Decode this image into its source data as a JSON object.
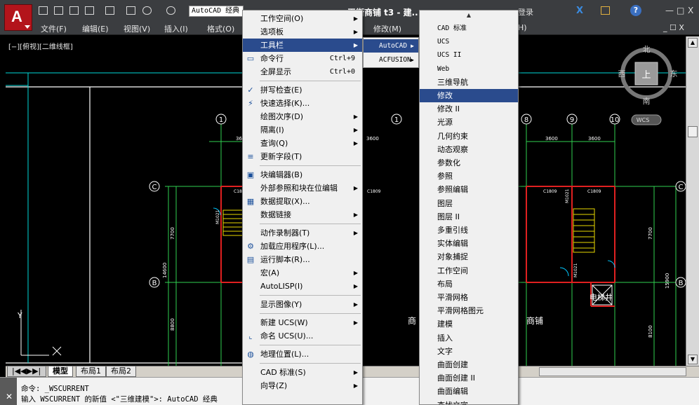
{
  "titlebar": {
    "workspace": "AutoCAD 经典",
    "doc_title": "平街商铺 t3 - 建...",
    "login": "登录",
    "min": "—",
    "max": "□",
    "close": "X",
    "help": "?"
  },
  "menubar": {
    "items": [
      "文件(F)",
      "编辑(E)",
      "视图(V)",
      "插入(I)",
      "格式(O)",
      "修改(M)",
      "H)"
    ],
    "win_restore": "_ ☐ X"
  },
  "viewport": {
    "label": "[−][俯视][二维线框]"
  },
  "navcube": {
    "north": "北",
    "south": "南",
    "east": "东",
    "west": "西",
    "top": "上",
    "wcs": "WCS"
  },
  "plan": {
    "grid_numbers": [
      "1",
      "5",
      "8",
      "9",
      "10"
    ],
    "grid_letters": [
      "C",
      "B",
      "C",
      "B"
    ],
    "dims": [
      "3600",
      "3600",
      "3600",
      "3600",
      "7700",
      "14600",
      "8800",
      "7700",
      "15900",
      "8100"
    ],
    "labels": [
      "C1809",
      "C1809",
      "C1809",
      "C1809",
      "M1021",
      "M1021",
      "M1021",
      "商铺",
      "商铺",
      "电梯井",
      "商"
    ]
  },
  "tabs": [
    "模型",
    "布局1",
    "布局2"
  ],
  "command": {
    "line1": "命令: _WSCURRENT",
    "line2": "输入 WSCURRENT 的新值 <\"三维建模\">: AutoCAD 经典"
  },
  "tools_menu": [
    {
      "label": "工作空间(O)",
      "arrow": true
    },
    {
      "label": "选项板",
      "arrow": true
    },
    {
      "label": "工具栏",
      "arrow": true,
      "highlight": true
    },
    {
      "label": "命令行",
      "shortcut": "Ctrl+9",
      "icon": "cmdline-icon"
    },
    {
      "label": "全屏显示",
      "shortcut": "Ctrl+0"
    },
    {
      "sep": true
    },
    {
      "label": "拼写检查(E)",
      "icon": "spellcheck-icon"
    },
    {
      "label": "快速选择(K)...",
      "icon": "quickselect-icon"
    },
    {
      "label": "绘图次序(D)",
      "arrow": true
    },
    {
      "label": "隔离(I)",
      "arrow": true
    },
    {
      "label": "查询(Q)",
      "arrow": true
    },
    {
      "label": "更新字段(T)",
      "icon": "updatefield-icon"
    },
    {
      "sep": true
    },
    {
      "label": "块编辑器(B)",
      "icon": "blockeditor-icon"
    },
    {
      "label": "外部参照和块在位编辑",
      "arrow": true
    },
    {
      "label": "数据提取(X)...",
      "icon": "dataextract-icon"
    },
    {
      "label": "数据链接",
      "arrow": true
    },
    {
      "sep": true
    },
    {
      "label": "动作录制器(T)",
      "arrow": true
    },
    {
      "label": "加载应用程序(L)...",
      "icon": "loadapp-icon"
    },
    {
      "label": "运行脚本(R)...",
      "icon": "script-icon"
    },
    {
      "label": "宏(A)",
      "arrow": true
    },
    {
      "label": "AutoLISP(I)",
      "arrow": true
    },
    {
      "sep": true
    },
    {
      "label": "显示图像(Y)",
      "arrow": true
    },
    {
      "sep": true
    },
    {
      "label": "新建 UCS(W)",
      "arrow": true
    },
    {
      "label": "命名 UCS(U)...",
      "icon": "ucs-icon"
    },
    {
      "sep": true
    },
    {
      "label": "地理位置(L)...",
      "icon": "geo-icon"
    },
    {
      "sep": true
    },
    {
      "label": "CAD 标准(S)",
      "arrow": true
    },
    {
      "label": "向导(Z)",
      "arrow": true
    }
  ],
  "toolbar_submenu": [
    {
      "label": "AutoCAD",
      "highlight": true
    },
    {
      "label": "ACFUSION"
    }
  ],
  "autocad_toolbars": [
    "CAD 标准",
    "UCS",
    "UCS II",
    "Web",
    "三维导航",
    "修改",
    "修改 II",
    "光源",
    "几何约束",
    "动态观察",
    "参数化",
    "参照",
    "参照编辑",
    "图层",
    "图层 II",
    "多重引线",
    "实体编辑",
    "对象捕捉",
    "工作空间",
    "布局",
    "平滑网格",
    "平滑网格图元",
    "建模",
    "插入",
    "文字",
    "曲面创建",
    "曲面创建 II",
    "曲面编辑",
    "查找文字"
  ],
  "autocad_highlight_index": 5,
  "colors": {
    "highlight": "#2a4b8d",
    "menu_bg": "#f0f0f0",
    "titlebar": "#3b3d40",
    "logo_red": "#b3141b"
  }
}
